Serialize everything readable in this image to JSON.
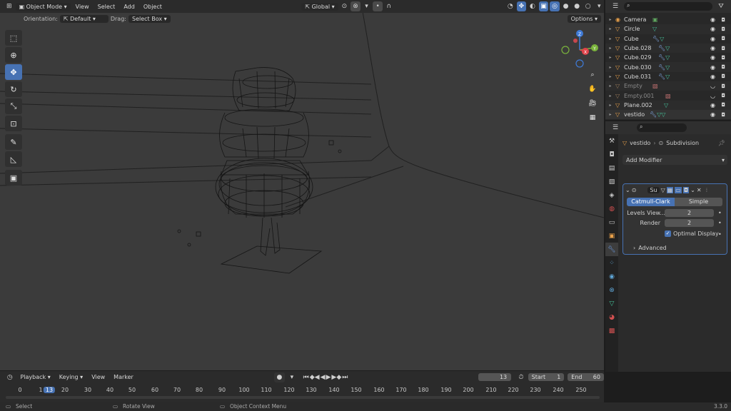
{
  "viewport": {
    "header": {
      "mode": "Object Mode",
      "menus": [
        "View",
        "Select",
        "Add",
        "Object"
      ],
      "transform_orientation": "Global"
    },
    "tool_settings": {
      "orientation_label": "Orientation:",
      "orientation_value": "Default",
      "drag_label": "Drag:",
      "drag_value": "Select Box",
      "options_label": "Options"
    },
    "tools": [
      "select-box",
      "cursor",
      "move",
      "rotate",
      "scale",
      "transform",
      "annotate",
      "measure",
      "add-cube"
    ],
    "active_tool": "move",
    "gizmo": {
      "x_label": "X",
      "y_label": "Y",
      "z_label": "Z",
      "x_color": "#e0434a",
      "y_color": "#7ab33c",
      "z_color": "#3f7ad6"
    }
  },
  "outliner": {
    "items": [
      {
        "name": "Camera",
        "icon": "camera-icon",
        "dim": false
      },
      {
        "name": "Circle",
        "icon": "mesh-icon",
        "dim": false
      },
      {
        "name": "Cube",
        "icon": "mesh-icon",
        "dim": false
      },
      {
        "name": "Cube.028",
        "icon": "mesh-icon",
        "dim": false
      },
      {
        "name": "Cube.029",
        "icon": "mesh-icon",
        "dim": false
      },
      {
        "name": "Cube.030",
        "icon": "mesh-icon",
        "dim": false
      },
      {
        "name": "Cube.031",
        "icon": "mesh-icon",
        "dim": false
      },
      {
        "name": "Empty",
        "icon": "empty-icon",
        "dim": true
      },
      {
        "name": "Empty.001",
        "icon": "empty-icon",
        "dim": true
      },
      {
        "name": "Plane.002",
        "icon": "mesh-icon",
        "dim": false
      },
      {
        "name": "vestido",
        "icon": "mesh-icon",
        "dim": false
      }
    ]
  },
  "properties": {
    "breadcrumb_object": "vestido",
    "breadcrumb_modifier": "Subdivision",
    "add_modifier_label": "Add Modifier",
    "modifier": {
      "name_short": "Su",
      "subdiv_types": [
        "Catmull-Clark",
        "Simple"
      ],
      "selected_type": "Catmull-Clark",
      "levels_viewport_label": "Levels View...",
      "levels_viewport_value": "2",
      "render_label": "Render",
      "render_value": "2",
      "optimal_display_label": "Optimal Display",
      "optimal_display_checked": true,
      "advanced_label": "Advanced"
    }
  },
  "timeline": {
    "menus": [
      "Playback",
      "Keying",
      "View",
      "Marker"
    ],
    "current_frame": "13",
    "start_label": "Start",
    "start_value": "1",
    "end_label": "End",
    "end_value": "60",
    "ticks": [
      "0",
      "1",
      "13",
      "20",
      "30",
      "40",
      "50",
      "60",
      "70",
      "80",
      "90",
      "100",
      "110",
      "120",
      "130",
      "140",
      "150",
      "160",
      "170",
      "180",
      "190",
      "200",
      "210",
      "220",
      "230",
      "240",
      "250"
    ]
  },
  "statusbar": {
    "select": "Select",
    "rotate_view": "Rotate View",
    "context_menu": "Object Context Menu",
    "version": "3.3.0"
  }
}
